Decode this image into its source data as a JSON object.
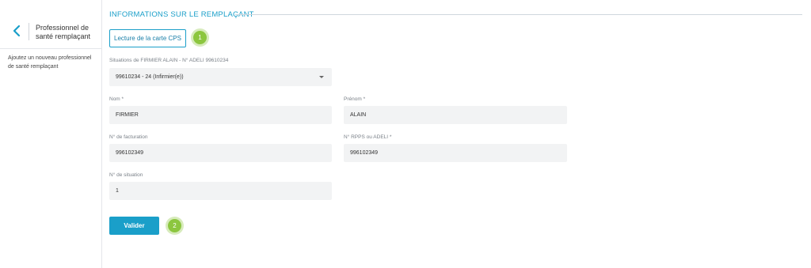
{
  "sidebar": {
    "title": "Professionnel de santé remplaçant",
    "description": "Ajoutez un nouveau professionnel de santé remplaçant",
    "back_icon": "chevron-left-icon"
  },
  "section": {
    "title": "INFORMATIONS SUR LE REMPLAÇANT"
  },
  "cps_button": {
    "label": "Lecture de la carte CPS",
    "step": "1"
  },
  "situations": {
    "label": "Situations de FIRMIER ALAIN - N° ADELI 99610234",
    "selected": "99610234 - 24 (Infirmier(e))"
  },
  "nom": {
    "label": "Nom *",
    "value": "FIRMIER"
  },
  "prenom": {
    "label": "Prénom *",
    "value": "ALAIN"
  },
  "facturation": {
    "label": "N° de facturation",
    "value": "996102349"
  },
  "rpps": {
    "label": "N° RPPS ou ADELI *",
    "value": "996102349"
  },
  "situation_num": {
    "label": "N° de situation",
    "value": "1"
  },
  "submit": {
    "label": "Valider",
    "step": "2"
  },
  "colors": {
    "accent": "#1a9fc9",
    "step_badge": "#8cc63f",
    "field_bg": "#f2f3f4"
  }
}
